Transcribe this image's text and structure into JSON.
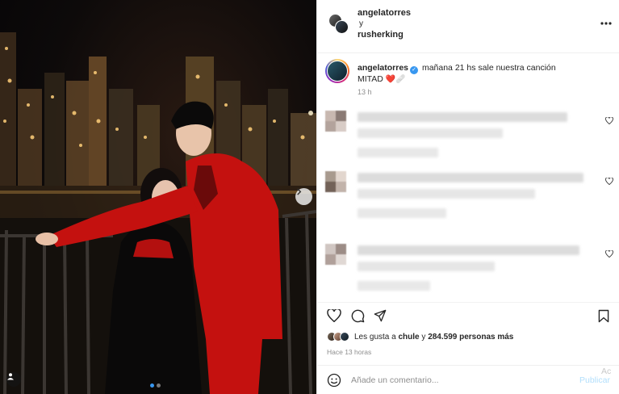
{
  "post": {
    "header": {
      "user1": "angelatorres",
      "and_word": "y",
      "user2": "rusherking"
    },
    "caption": {
      "username": "angelatorres",
      "verified_mark": "✓",
      "text_line1": "mañana 21 hs sale nuestra canción",
      "text_line2": "MITAD",
      "emojis": "❤️🩹",
      "time": "13 h"
    },
    "likes": {
      "prefix": "Les gusta a",
      "user": "chule",
      "connector": "y",
      "count": "284.599 personas más"
    },
    "ago": "Hace 13 horas",
    "comment_input": {
      "placeholder": "Añade un comentario...",
      "publish_label": "Publicar"
    },
    "watermark": "Ac"
  },
  "icons": {
    "more": "more-options-icon",
    "like": "heart-icon",
    "comment": "comment-icon",
    "share": "share-icon",
    "save": "bookmark-icon",
    "emoji": "emoji-icon",
    "next": "chevron-right-icon",
    "tag": "user-tag-icon"
  },
  "carousel": {
    "slides": 2,
    "active_index": 0
  },
  "colors": {
    "accent_blue": "#3897f0",
    "publish_disabled": "#b2dffc",
    "secondary_text": "#8e8e8e",
    "suit_red": "#c4110f"
  }
}
